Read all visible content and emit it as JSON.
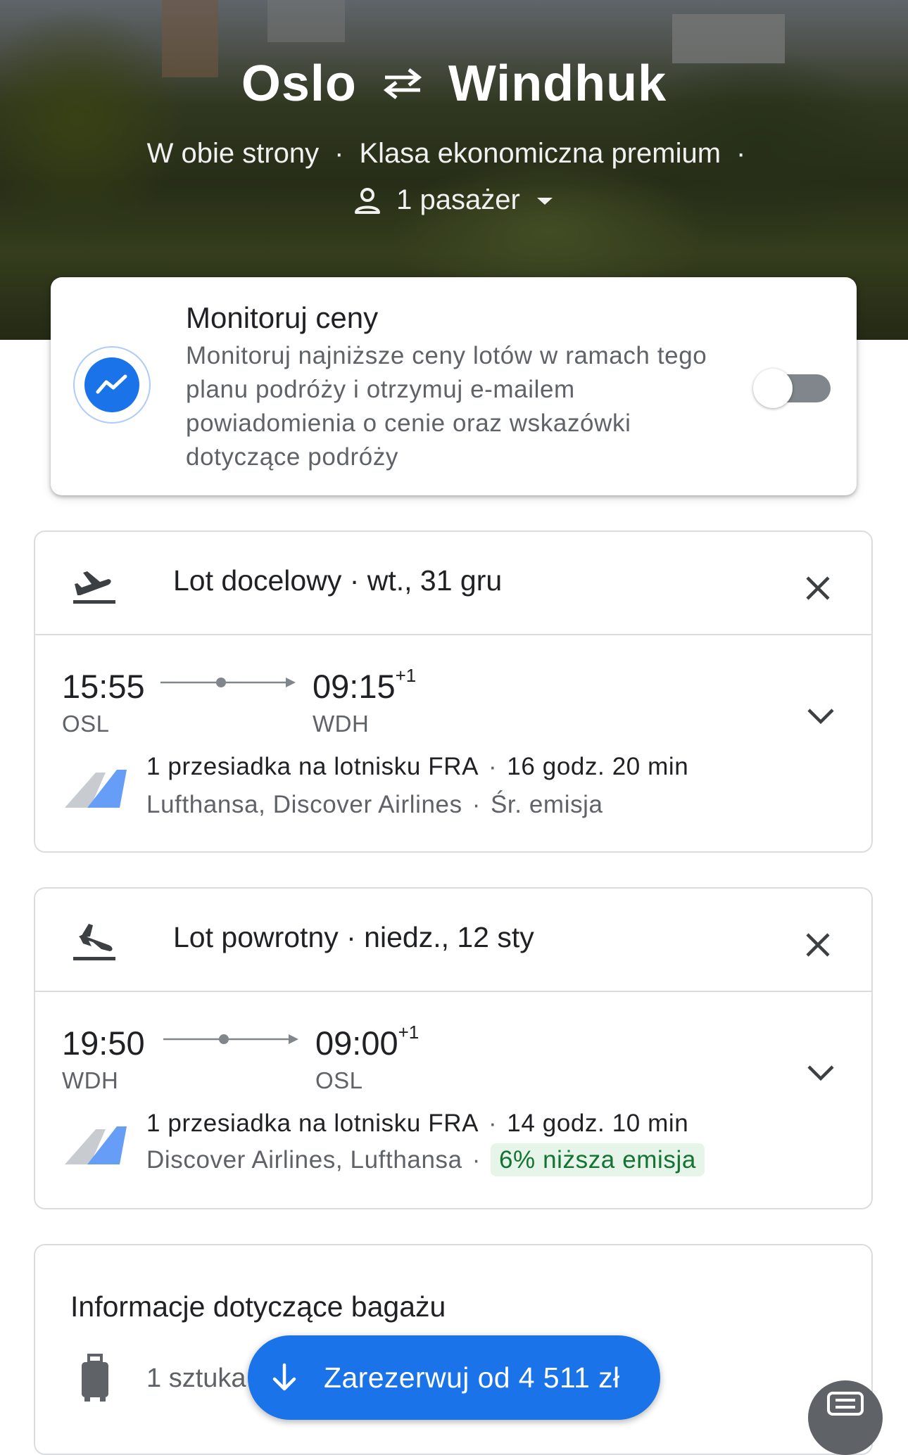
{
  "hero": {
    "origin": "Oslo",
    "destination": "Windhuk",
    "trip_type": "W obie strony",
    "cabin_class": "Klasa ekonomiczna premium",
    "passengers": "1 pasażer"
  },
  "price_tracking": {
    "title": "Monitoruj ceny",
    "description": "Monitoruj najniższe ceny lotów w ramach tego planu podróży i otrzymuj e-mailem powiadomienia o cenie oraz wskazówki dotyczące podróży",
    "enabled": false
  },
  "outbound": {
    "title": "Lot docelowy · wt., 31 gru",
    "depart_time": "15:55",
    "depart_code": "OSL",
    "arrive_time": "09:15",
    "arrive_offset": "+1",
    "arrive_code": "WDH",
    "stops": "1 przesiadka na lotnisku FRA",
    "duration": "16 godz. 20 min",
    "airlines": "Lufthansa, Discover Airlines",
    "emissions": "Śr. emisja"
  },
  "return": {
    "title": "Lot powrotny · niedz., 12 sty",
    "depart_time": "19:50",
    "depart_code": "WDH",
    "arrive_time": "09:00",
    "arrive_offset": "+1",
    "arrive_code": "OSL",
    "stops": "1 przesiadka na lotnisku FRA",
    "duration": "14 godz. 10 min",
    "airlines": "Discover Airlines, Lufthansa",
    "emissions": "6% niższa emisja"
  },
  "baggage": {
    "title": "Informacje dotyczące bagażu",
    "item": "1 sztuka"
  },
  "book_button": {
    "label": "Zarezerwuj od 4 511 zł"
  },
  "colors": {
    "accent": "#1a73e8",
    "low_emission_bg": "#e6f4ea",
    "low_emission_text": "#137333"
  },
  "icons": [
    "swap-arrows-icon",
    "person-icon",
    "dropdown-triangle-icon",
    "trend-chart-icon",
    "takeoff-icon",
    "landing-icon",
    "close-icon",
    "chevron-down-icon",
    "airline-logo",
    "luggage-icon",
    "arrow-down-icon",
    "menu-icon"
  ]
}
